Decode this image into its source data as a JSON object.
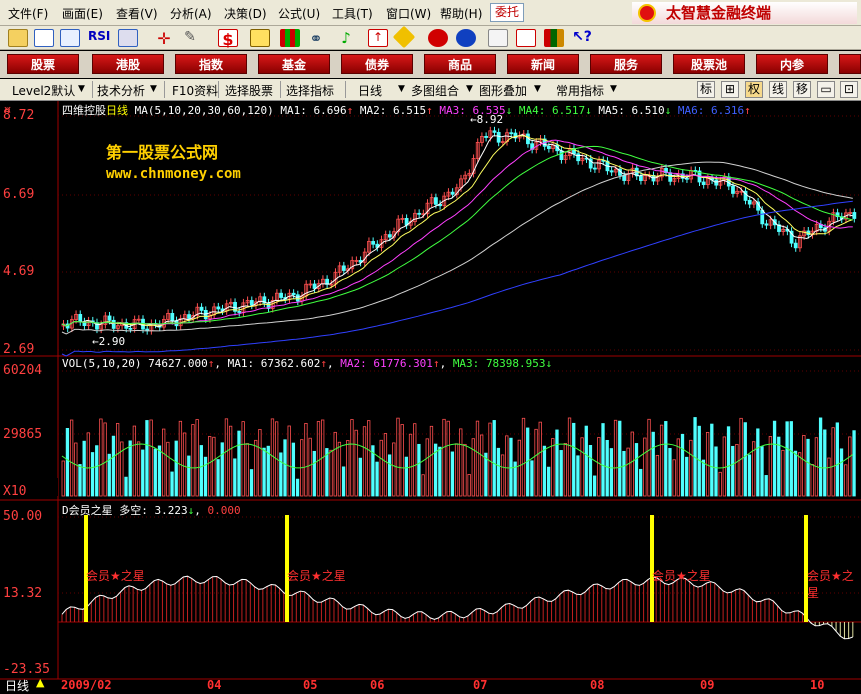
{
  "menu": {
    "items": [
      "文件(F)",
      "画面(E)",
      "查看(V)",
      "分析(A)",
      "决策(D)",
      "公式(U)",
      "工具(T)",
      "窗口(W)",
      "帮助(H)"
    ],
    "trust": "委托",
    "brand": "太智慧金融终端"
  },
  "toolbar": {
    "rsi_label": "RSI"
  },
  "nav": {
    "items": [
      "股票",
      "港股",
      "指数",
      "基金",
      "债券",
      "商品",
      "新闻",
      "服务",
      "股票池",
      "内参"
    ]
  },
  "subnav": {
    "level2": "Level2默认",
    "tech": "技术分析",
    "f10": "F10资料",
    "select": "选择股票",
    "indicator": "选择指标",
    "daily": "日线",
    "multi": "多图组合",
    "overlay": "图形叠加",
    "common": "常用指标",
    "icons": [
      "标",
      "⊞",
      "权",
      "线",
      "移"
    ]
  },
  "price_panel": {
    "stock": "四维控股",
    "period": "日线",
    "ma_title": "MA(5,10,20,30,60,120)",
    "ma_values": [
      {
        "label": "MA1:",
        "value": "6.696",
        "arrow": "↑",
        "color": "#ffffff"
      },
      {
        "label": "MA2:",
        "value": "6.515",
        "arrow": "↑",
        "color": "#ffffff"
      },
      {
        "label": "MA3:",
        "value": "6.535",
        "arrow": "↓",
        "color": "#ff40ff"
      },
      {
        "label": "MA4:",
        "value": "6.517",
        "arrow": "↓",
        "color": "#40ff40"
      },
      {
        "label": "MA5:",
        "value": "6.510",
        "arrow": "↓",
        "color": "#ffffff"
      },
      {
        "label": "MA6:",
        "value": "6.316",
        "arrow": "↑",
        "color": "#4060ff"
      }
    ],
    "y_labels": [
      "8.72",
      "6.69",
      "4.69",
      "2.69"
    ],
    "watermark1": "第一股票公式网",
    "watermark2": "www.chnmoney.com",
    "low_label": "2.90",
    "high_label": "8.92"
  },
  "vol_panel": {
    "title": "VOL(5,10,20)",
    "value": "74627.000",
    "ma_values": [
      {
        "label": "MA1:",
        "value": "67362.602",
        "arrow": "↑",
        "color": "#ffffff"
      },
      {
        "label": "MA2:",
        "value": "61776.301",
        "arrow": "↑",
        "color": "#ff40ff"
      },
      {
        "label": "MA3:",
        "value": "78398.953",
        "arrow": "↓",
        "color": "#40ff40"
      }
    ],
    "y_labels": [
      "60204",
      "29865"
    ],
    "unit": "X10"
  },
  "ind_panel": {
    "name": "D会员之星",
    "label": "多空:",
    "value": "3.223",
    "arrow": "↓",
    "second": "0.000",
    "y_labels": [
      "50.00",
      "13.32",
      "-23.35"
    ],
    "signal": "会员★之星"
  },
  "date_axis": {
    "period": "日线",
    "labels": [
      "2009/02",
      "04",
      "05",
      "06",
      "07",
      "08",
      "09",
      "10"
    ]
  },
  "colors": {
    "up": "#ff5050",
    "down": "#50ffff",
    "ma1": "#ffffff",
    "ma2": "#ffff60",
    "ma3": "#ff40ff",
    "ma4": "#40ff40",
    "ma5": "#d0d0d0",
    "ma6": "#3040ff",
    "signal": "#ffff00"
  }
}
